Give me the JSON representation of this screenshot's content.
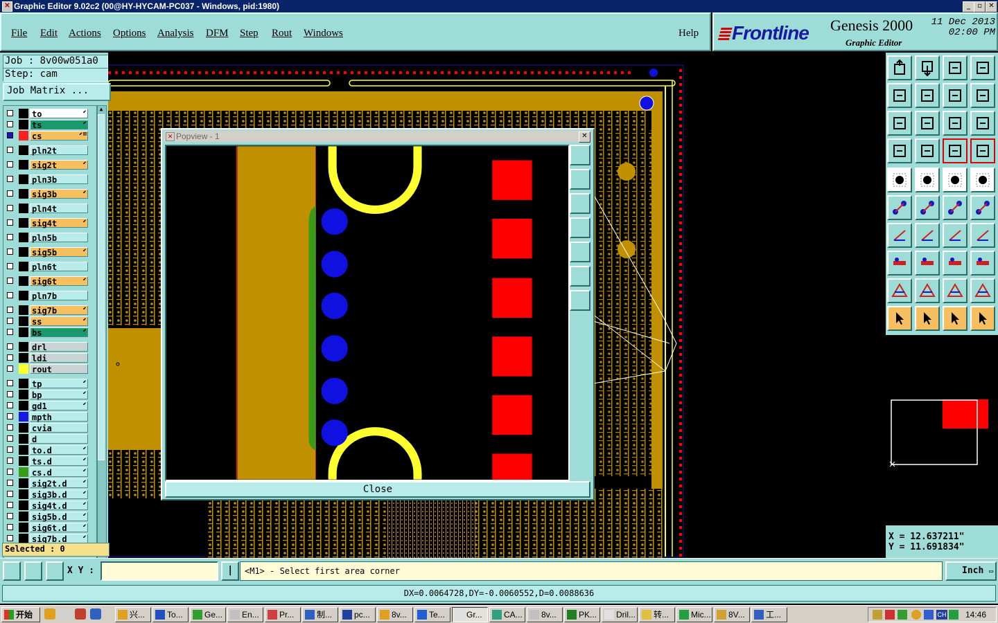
{
  "window": {
    "title": "Graphic Editor 9.02c2 (00@HY-HYCAM-PC037 - Windows, pid:1980)"
  },
  "menu": {
    "items": [
      "File",
      "Edit",
      "Actions",
      "Options",
      "Analysis",
      "DFM",
      "Step",
      "Rout",
      "Windows"
    ],
    "help": "Help"
  },
  "brand": {
    "logo": "Frontline",
    "product": "Genesis 2000",
    "subtitle": "Graphic Editor",
    "date": "11 Dec 2013",
    "time": "02:00 PM"
  },
  "job": {
    "job_line": "Job : 8v00w051a0",
    "step_line": "Step: cam",
    "matrix_button": "Job Matrix ..."
  },
  "layers": [
    {
      "name": "to",
      "swatch": "#000",
      "bg": "#ffffff",
      "pen": "⬋",
      "checked": false
    },
    {
      "name": "ts",
      "swatch": "#000",
      "bg": "#1a9a6a",
      "pen": "⬋",
      "checked": false
    },
    {
      "name": "cs",
      "swatch": "#ff2020",
      "bg": "#f6c060",
      "pen": "⬋⊞",
      "checked": true
    },
    {
      "name": "pln2t",
      "swatch": "#000",
      "bg": "#b8ecea",
      "pen": "",
      "checked": false
    },
    {
      "name": "sig2t",
      "swatch": "#000",
      "bg": "#f6c060",
      "pen": "⬋",
      "checked": false
    },
    {
      "name": "pln3b",
      "swatch": "#000",
      "bg": "#b8ecea",
      "pen": "",
      "checked": false
    },
    {
      "name": "sig3b",
      "swatch": "#000",
      "bg": "#f6c060",
      "pen": "⬋",
      "checked": false
    },
    {
      "name": "pln4t",
      "swatch": "#000",
      "bg": "#b8ecea",
      "pen": "",
      "checked": false
    },
    {
      "name": "sig4t",
      "swatch": "#000",
      "bg": "#f6c060",
      "pen": "⬋",
      "checked": false
    },
    {
      "name": "pln5b",
      "swatch": "#000",
      "bg": "#b8ecea",
      "pen": "",
      "checked": false
    },
    {
      "name": "sig5b",
      "swatch": "#000",
      "bg": "#f6c060",
      "pen": "⬋",
      "checked": false
    },
    {
      "name": "pln6t",
      "swatch": "#000",
      "bg": "#b8ecea",
      "pen": "",
      "checked": false
    },
    {
      "name": "sig6t",
      "swatch": "#000",
      "bg": "#f6c060",
      "pen": "⬋",
      "checked": false
    },
    {
      "name": "pln7b",
      "swatch": "#000",
      "bg": "#b8ecea",
      "pen": "",
      "checked": false
    },
    {
      "name": "sig7b",
      "swatch": "#000",
      "bg": "#f6c060",
      "pen": "⬋",
      "checked": false
    },
    {
      "name": "ss",
      "swatch": "#000",
      "bg": "#f6c060",
      "pen": "⬋",
      "checked": false
    },
    {
      "name": "bs",
      "swatch": "#000",
      "bg": "#1a9a6a",
      "pen": "⬋",
      "checked": false
    },
    {
      "name": "drl",
      "swatch": "#000",
      "bg": "#c8d4d4",
      "pen": "",
      "checked": false
    },
    {
      "name": "ldi",
      "swatch": "#000",
      "bg": "#c8d4d4",
      "pen": "",
      "checked": false
    },
    {
      "name": "rout",
      "swatch": "#ffff30",
      "bg": "#c8d4d4",
      "pen": "",
      "checked": false
    },
    {
      "name": "tp",
      "swatch": "#000",
      "bg": "#b8ecea",
      "pen": "⬋",
      "checked": false
    },
    {
      "name": "bp",
      "swatch": "#000",
      "bg": "#b8ecea",
      "pen": "⬋",
      "checked": false
    },
    {
      "name": "gd1",
      "swatch": "#000",
      "bg": "#b8ecea",
      "pen": "⬋",
      "checked": false
    },
    {
      "name": "mpth",
      "swatch": "#1818e0",
      "bg": "#b8ecea",
      "pen": "",
      "checked": false
    },
    {
      "name": "cvia",
      "swatch": "#000",
      "bg": "#b8ecea",
      "pen": "",
      "checked": false
    },
    {
      "name": "d",
      "swatch": "#000",
      "bg": "#b8ecea",
      "pen": "",
      "checked": false
    },
    {
      "name": "to.d",
      "swatch": "#000",
      "bg": "#b8ecea",
      "pen": "⬋",
      "checked": false
    },
    {
      "name": "ts.d",
      "swatch": "#000",
      "bg": "#b8ecea",
      "pen": "⬋",
      "checked": false
    },
    {
      "name": "cs.d",
      "swatch": "#3a9a1a",
      "bg": "#b8ecea",
      "pen": "⬋",
      "checked": false
    },
    {
      "name": "sig2t.d",
      "swatch": "#000",
      "bg": "#b8ecea",
      "pen": "⬋",
      "checked": false
    },
    {
      "name": "sig3b.d",
      "swatch": "#000",
      "bg": "#b8ecea",
      "pen": "⬋",
      "checked": false
    },
    {
      "name": "sig4t.d",
      "swatch": "#000",
      "bg": "#b8ecea",
      "pen": "⬋",
      "checked": false
    },
    {
      "name": "sig5b.d",
      "swatch": "#000",
      "bg": "#b8ecea",
      "pen": "⬋",
      "checked": false
    },
    {
      "name": "sig6t.d",
      "swatch": "#000",
      "bg": "#b8ecea",
      "pen": "⬋",
      "checked": false
    },
    {
      "name": "sig7b.d",
      "swatch": "#000",
      "bg": "#b8ecea",
      "pen": "⬋",
      "checked": false
    }
  ],
  "selected": "Selected : 0",
  "popview": {
    "title": "Popview - 1",
    "close_label": "Close"
  },
  "coords": {
    "x": "X =  12.637211\"",
    "y": "Y =  11.691834\""
  },
  "command": {
    "xy_label": "X Y :",
    "xy_value": "",
    "prompt": "<M1> - Select first area corner",
    "units": "Inch"
  },
  "measure": "DX=0.0064728,DY=-0.0060552,D=0.0088636",
  "taskbar": {
    "start": "开始",
    "tasks": [
      "兴...",
      "To...",
      "Ge...",
      "En...",
      "Pr...",
      "制...",
      "pc...",
      "8v...",
      "Te...",
      "Gr...",
      "CA...",
      "8v...",
      "PK...",
      "Dril...",
      "转...",
      "Mic...",
      "8V...",
      "工..."
    ],
    "clock": "14:46",
    "lang": "CH"
  },
  "colors": {
    "panel": "#9edcd8",
    "copper": "#c09000",
    "pad": "#ff0000",
    "via": "#1010e0",
    "rout": "#ffff30"
  }
}
